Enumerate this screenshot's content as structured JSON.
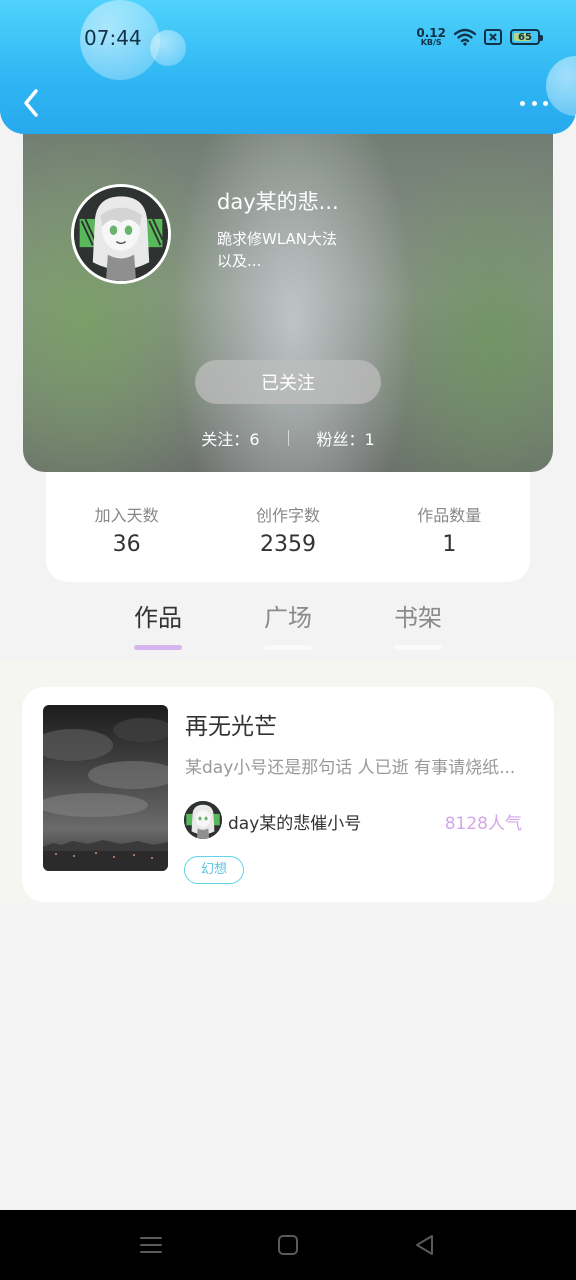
{
  "status_bar": {
    "time": "07:44",
    "net_speed_value": "0.12",
    "net_speed_unit": "KB/S",
    "battery": "65",
    "icons": [
      "wifi-icon",
      "sim-icon",
      "battery-icon"
    ]
  },
  "header": {
    "back_icon": "chevron-left-icon",
    "more_icon": "more-dots-icon"
  },
  "profile": {
    "name": "day某的悲...",
    "bio_line1": "跪求修WLAN大法",
    "bio_line2": "以及...",
    "follow_label": "已关注",
    "following_label": "关注：",
    "following_count": "6",
    "followers_label": "粉丝：",
    "followers_count": "1"
  },
  "stats": [
    {
      "label": "加入天数",
      "value": "36"
    },
    {
      "label": "创作字数",
      "value": "2359"
    },
    {
      "label": "作品数量",
      "value": "1"
    }
  ],
  "tabs": [
    {
      "label": "作品",
      "active": true
    },
    {
      "label": "广场",
      "active": false
    },
    {
      "label": "书架",
      "active": false
    }
  ],
  "works": [
    {
      "title": "再无光芒",
      "description": "某day小号还是那句话 人已逝 有事请烧纸...",
      "author": "day某的悲催小号",
      "popularity": "8128人气",
      "tag": "幻想"
    }
  ],
  "colors": {
    "header_blue": "#2fb6f3",
    "accent_purple": "#d6b6ee",
    "tag_cyan": "#5fd3e8",
    "popularity_purple": "#d3a7ec"
  },
  "navbar": {
    "icons": [
      "menu-icon",
      "home-square-icon",
      "back-triangle-icon"
    ]
  }
}
